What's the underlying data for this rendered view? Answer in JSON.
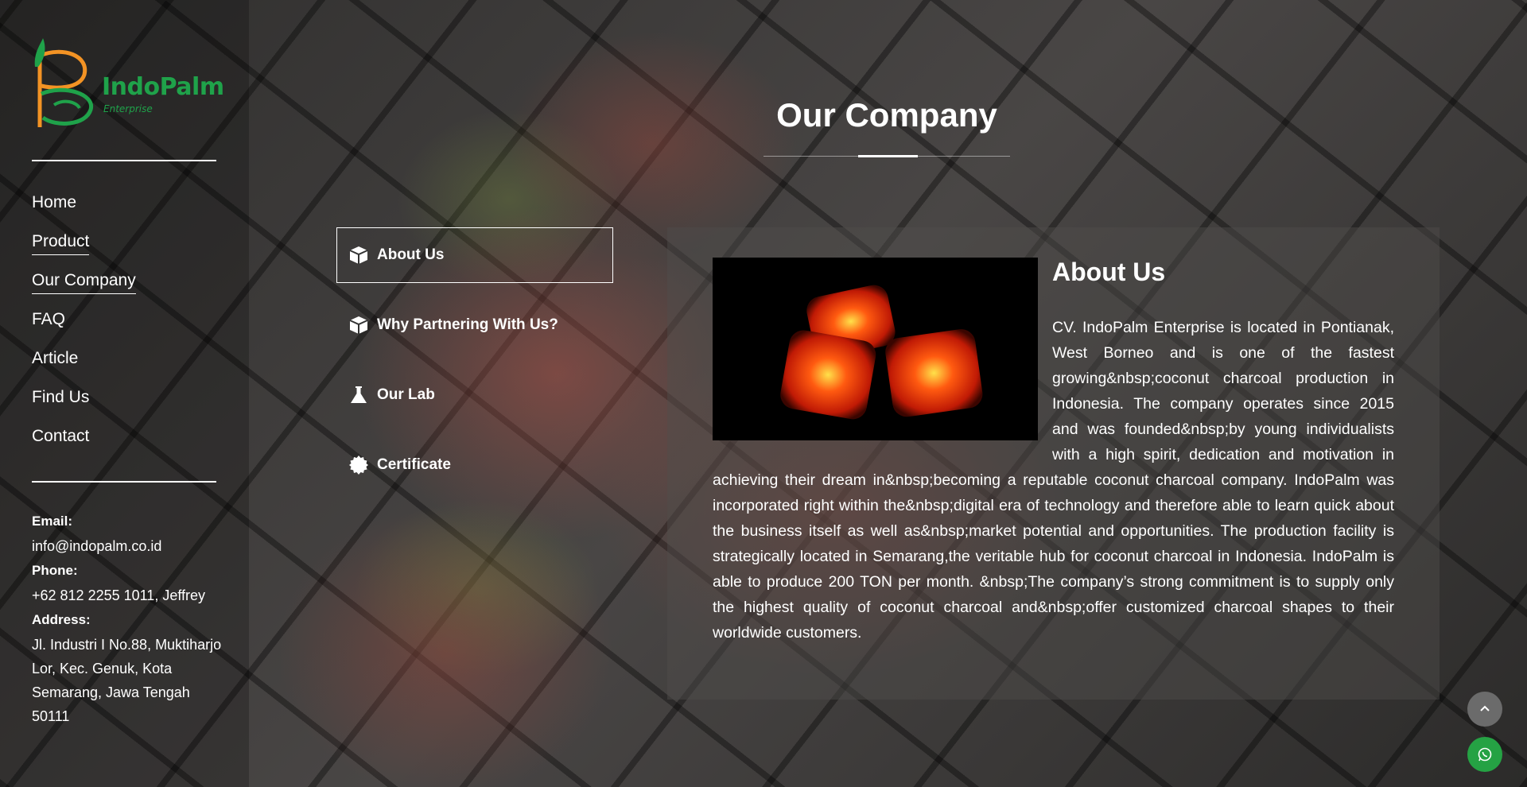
{
  "brand": {
    "name": "IndoPalm",
    "subtitle": "Enterprise",
    "colors": {
      "green": "#1fa24a",
      "orange": "#f39324"
    }
  },
  "sidebar": {
    "nav": [
      {
        "label": "Home"
      },
      {
        "label": "Product"
      },
      {
        "label": "Our Company"
      },
      {
        "label": "FAQ"
      },
      {
        "label": "Article"
      },
      {
        "label": "Find Us"
      },
      {
        "label": "Contact"
      }
    ],
    "contact": {
      "email_label": "Email:",
      "email": "info@indopalm.co.id",
      "phone_label": "Phone:",
      "phone": "+62 812 2255 1011, Jeffrey",
      "address_label": "Address:",
      "address": "Jl. Industri I No.88, Muktiharjo Lor, Kec. Genuk, Kota Semarang, Jawa Tengah 50111"
    }
  },
  "page": {
    "title": "Our Company"
  },
  "tabs": [
    {
      "label": "About Us",
      "icon": "cube-icon",
      "active": true
    },
    {
      "label": "Why Partnering With Us?",
      "icon": "cube-icon",
      "active": false
    },
    {
      "label": "Our Lab",
      "icon": "flask-icon",
      "active": false
    },
    {
      "label": "Certificate",
      "icon": "certificate-icon",
      "active": false
    }
  ],
  "panel": {
    "title": "About Us",
    "body": "CV. IndoPalm Enterprise is located in Pontianak, West Borneo and is one of the fastest growing&nbsp;coconut charcoal production in Indonesia. The company operates since 2015 and was founded&nbsp;by young individualists with a high spirit, dedication and motivation in achieving their dream in&nbsp;becoming a reputable coconut charcoal company. IndoPalm was incorporated right within the&nbsp;digital era of technology and therefore able to learn quick about the business itself as well as&nbsp;market potential and opportunities. The production facility is strategically located in Semarang,the veritable hub for coconut charcoal in Indonesia. IndoPalm is able to produce 200 TON per month. &nbsp;The company’s strong commitment is to supply only the highest quality of coconut charcoal and&nbsp;offer customized charcoal shapes to their worldwide customers."
  },
  "floating": {
    "scroll_top_icon": "chevron-up-icon",
    "whatsapp_icon": "whatsapp-icon"
  }
}
